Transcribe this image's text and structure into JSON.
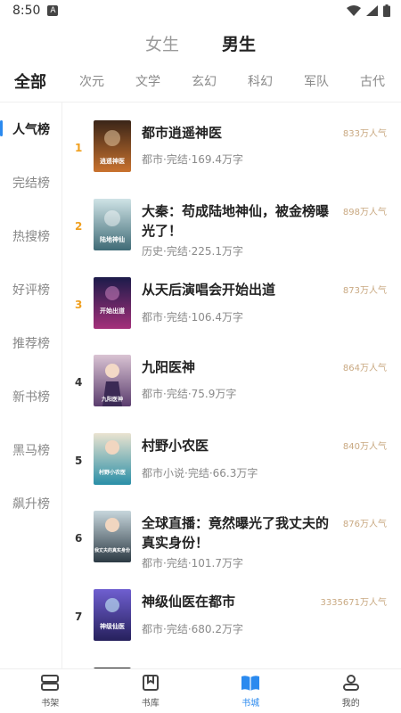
{
  "status": {
    "time": "8:50",
    "notif": "A"
  },
  "gender_tabs": [
    {
      "label": "女生"
    },
    {
      "label": "男生"
    }
  ],
  "categories": [
    {
      "label": "全部"
    },
    {
      "label": "次元"
    },
    {
      "label": "文学"
    },
    {
      "label": "玄幻"
    },
    {
      "label": "科幻"
    },
    {
      "label": "军队"
    },
    {
      "label": "古代"
    }
  ],
  "rank_types": [
    {
      "label": "人气榜"
    },
    {
      "label": "完结榜"
    },
    {
      "label": "热搜榜"
    },
    {
      "label": "好评榜"
    },
    {
      "label": "推荐榜"
    },
    {
      "label": "新书榜"
    },
    {
      "label": "黑马榜"
    },
    {
      "label": "飙升榜"
    }
  ],
  "books": [
    {
      "rank": "1",
      "title": "都市逍遥神医",
      "meta": "都市·完结·169.4万字",
      "heat": "833万人气",
      "cover_text": "逍遥神医",
      "c1": "#3a2518",
      "c2": "#c9722e"
    },
    {
      "rank": "2",
      "title": "大秦：苟成陆地神仙，被金榜曝光了！",
      "meta": "历史·完结·225.1万字",
      "heat": "898万人气",
      "cover_text": "陆地神仙",
      "c1": "#cfe3e6",
      "c2": "#3f6b76"
    },
    {
      "rank": "3",
      "title": "从天后演唱会开始出道",
      "meta": "都市·完结·106.4万字",
      "heat": "873万人气",
      "cover_text": "开始出道",
      "c1": "#1c1b4a",
      "c2": "#a4307a"
    },
    {
      "rank": "4",
      "title": "九阳医神",
      "meta": "都市·完结·75.9万字",
      "heat": "864万人气",
      "cover_text": "九阳医神",
      "c1": "#5b3d6e",
      "c2": "#d9c3d3"
    },
    {
      "rank": "5",
      "title": "村野小农医",
      "meta": "都市小说·完结·66.3万字",
      "heat": "840万人气",
      "cover_text": "村野小农医",
      "c1": "#2a8fa7",
      "c2": "#eae3d0"
    },
    {
      "rank": "6",
      "title": "全球直播：竟然曝光了我丈夫的真实身份！",
      "meta": "都市·完结·101.7万字",
      "heat": "876万人气",
      "cover_text": "我丈夫的真实身份",
      "c1": "#c7d6dc",
      "c2": "#2c3a44"
    },
    {
      "rank": "7",
      "title": "神级仙医在都市",
      "meta": "都市·完结·680.2万字",
      "heat": "3335671万人气",
      "cover_text": "神级仙医",
      "c1": "#26205c",
      "c2": "#6f5fd0"
    }
  ],
  "tabbar": [
    {
      "label": "书架"
    },
    {
      "label": "书库"
    },
    {
      "label": "书城"
    },
    {
      "label": "我的"
    }
  ]
}
